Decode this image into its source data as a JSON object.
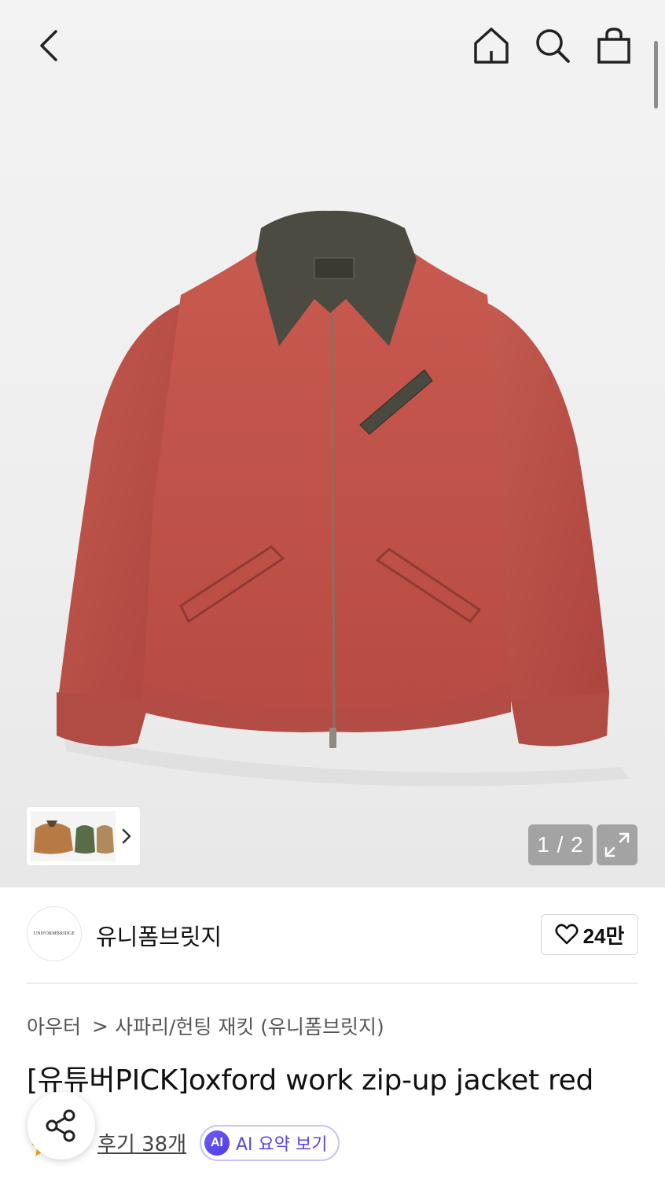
{
  "header": {
    "back_icon": "chevron-left-icon",
    "home_icon": "home-icon",
    "search_icon": "search-icon",
    "bag_icon": "shopping-bag-icon"
  },
  "gallery": {
    "current_page": "1",
    "page_separator": "/",
    "total_pages": "2",
    "counter_text": "1 / 2",
    "expand_icon": "expand-icon",
    "thumbnail_more_icon": "chevron-right-icon",
    "product_color": "#c0544a",
    "collar_color": "#4a4a42"
  },
  "brand": {
    "logo_text": "UNIFORMBRIDGE",
    "name": "유니폼브릿지",
    "like_icon": "heart-icon",
    "like_count": "24만"
  },
  "breadcrumb": {
    "category": "아우터",
    "separator": ">",
    "subcategory": "사파리/헌팅 재킷 (유니폼브릿지)"
  },
  "product": {
    "title": "[유튜버PICK]oxford work zip-up jacket red"
  },
  "reviews": {
    "link_text": "후기 38개",
    "star_icon": "star-icon",
    "ai_badge_text": "AI",
    "ai_summary_label": "AI 요약 보기",
    "accent_color": "#5a45e8"
  },
  "floating": {
    "share_icon": "share-icon"
  }
}
